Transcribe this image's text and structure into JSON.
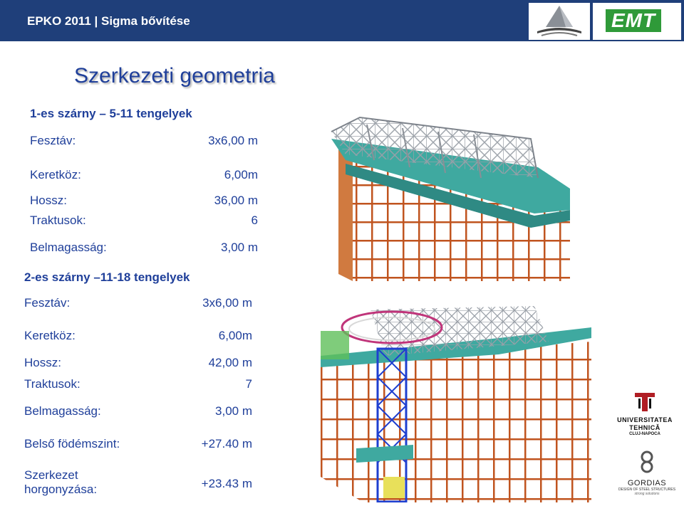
{
  "header": {
    "title": "EPKO 2011 | Sigma bővítése",
    "emt_logo": "EMT",
    "logo_icons": [
      "pyramid-logo-icon",
      "emt-logo-icon"
    ]
  },
  "main": {
    "title": "Szerkezeti geometria",
    "section1": {
      "title": "1-es szárny – 5-11 tengelyek",
      "rows": [
        {
          "label": "Fesztáv:",
          "value": "3x6,00 m"
        },
        {
          "label": "Keretköz:",
          "value": "6,00m"
        },
        {
          "label": "Hossz:",
          "value": "36,00 m"
        },
        {
          "label": "Traktusok:",
          "value": "6"
        },
        {
          "label": "Belmagasság:",
          "value": "3,00 m"
        }
      ]
    },
    "section2": {
      "title": "2-es szárny –11-18 tengelyek",
      "rows": [
        {
          "label": "Fesztáv:",
          "value": "3x6,00 m"
        },
        {
          "label": "Keretköz:",
          "value": "6,00m"
        },
        {
          "label": "Hossz:",
          "value": "42,00 m"
        },
        {
          "label": "Traktusok:",
          "value": "7"
        },
        {
          "label": "Belmagasság:",
          "value": "3,00 m"
        },
        {
          "label": "Belső födémszint:",
          "value": "+27.40 m"
        },
        {
          "label": "Szerkezet horgonyzása:",
          "value": "+23.43 m"
        }
      ]
    }
  },
  "logos": {
    "university": {
      "line1": "UNIVERSITATEA",
      "line2": "TEHNICĂ",
      "line3": "CLUJ-NAPOCA"
    },
    "gordias": {
      "name": "GORDIAS",
      "sub1": "DESIGN OF STEEL STRUCTURES",
      "tagline": "strong solutions"
    }
  },
  "colors": {
    "header_bg": "#1f3f7a",
    "text_blue": "#1f3f9a",
    "frame_orange": "#c8642a",
    "slab_teal": "#3aa6a0",
    "emt_green": "#2f9a39"
  }
}
